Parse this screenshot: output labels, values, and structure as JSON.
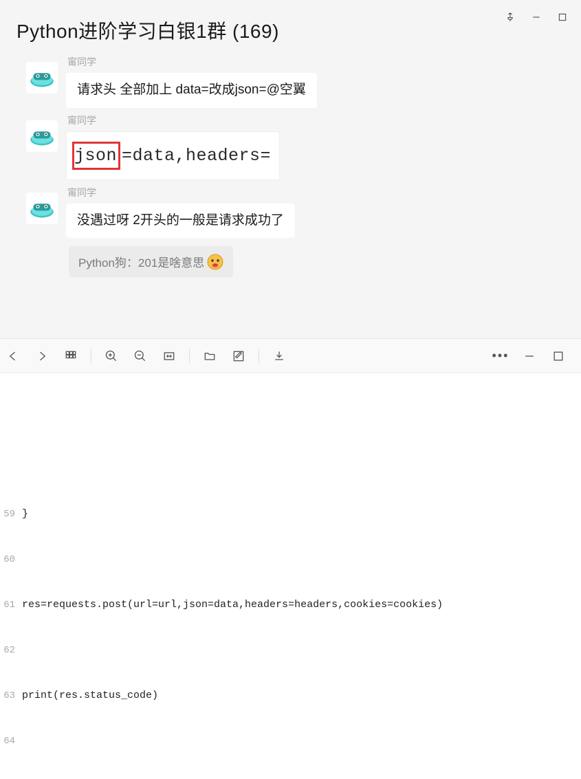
{
  "chat": {
    "title": "Python进阶学习白银1群 (169)",
    "messages": [
      {
        "sender": "甯同学",
        "text": "请求头 全部加上 data=改成json=@空翼"
      },
      {
        "sender": "甯同学",
        "code_pre": "json",
        "code_post": "=data,headers="
      },
      {
        "sender": "甯同学",
        "text": "没遇过呀 2开头的一般是请求成功了"
      }
    ],
    "quote": "Python狗：201是啥意思"
  },
  "editor": {
    "lines": [
      {
        "n": "59",
        "t": "}"
      },
      {
        "n": "60",
        "t": ""
      },
      {
        "n": "61",
        "t": "res=requests.post(url=url,json=data,headers=headers,cookies=cookies)"
      },
      {
        "n": "62",
        "t": ""
      },
      {
        "n": "63",
        "t": "print(res.status_code)"
      },
      {
        "n": "64",
        "t": ""
      }
    ]
  }
}
